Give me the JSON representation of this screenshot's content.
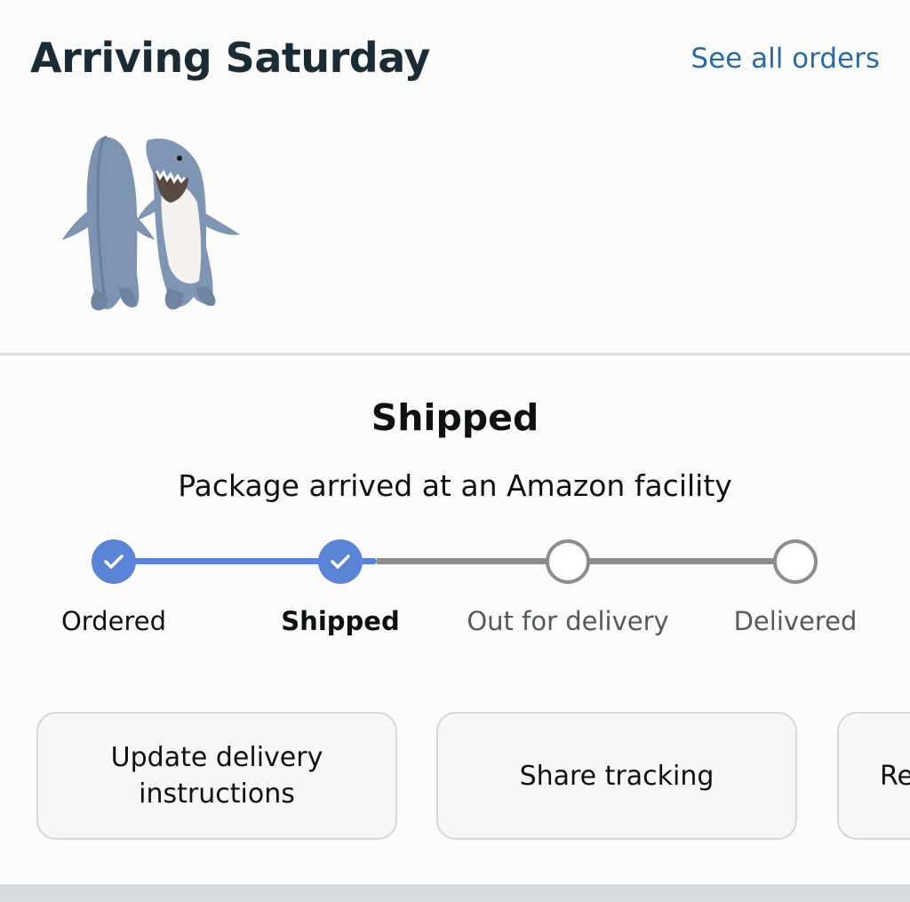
{
  "header": {
    "title": "Arriving Saturday",
    "see_all_orders": "See all orders"
  },
  "product": {
    "image_icon": "shark-blanket-product-image"
  },
  "status": {
    "title": "Shipped",
    "subtitle": "Package arrived at an Amazon facility"
  },
  "tracker": {
    "progress_step": 2,
    "steps": [
      {
        "label": "Ordered",
        "state": "done"
      },
      {
        "label": "Shipped",
        "state": "current"
      },
      {
        "label": "Out for delivery",
        "state": "pending"
      },
      {
        "label": "Delivered",
        "state": "pending"
      }
    ],
    "colors": {
      "done": "#5a85d6",
      "pending": "#8d8d8d"
    }
  },
  "actions": {
    "update_line1": "Update delivery",
    "update_line2": "instructions",
    "share": "Share tracking",
    "third_partial": "Re"
  }
}
